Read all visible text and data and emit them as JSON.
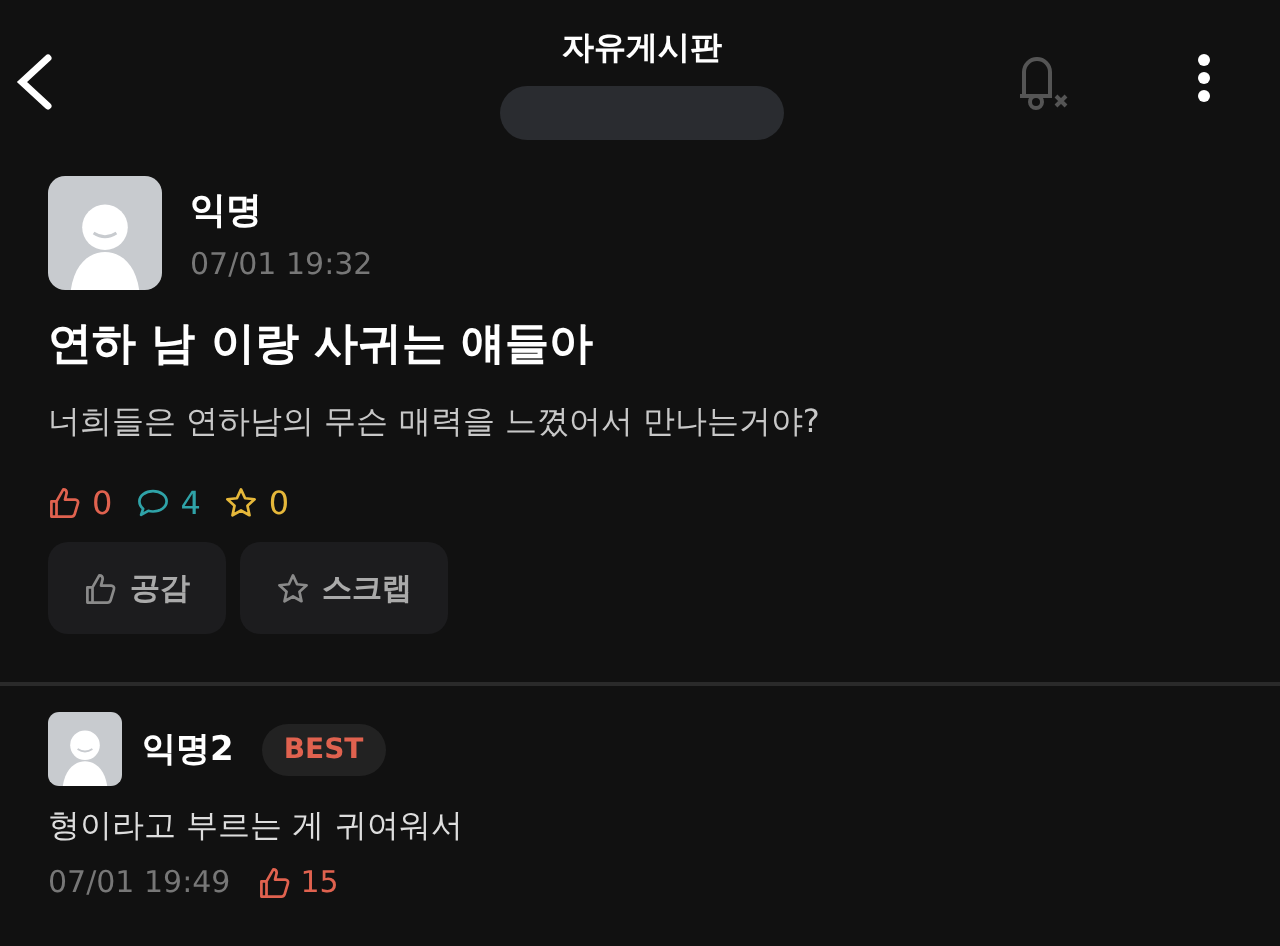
{
  "header": {
    "title": "자유게시판"
  },
  "post": {
    "author": "익명",
    "time": "07/01 19:32",
    "title": "연하 남 이랑 사귀는 얘들아",
    "body": "너희들은 연하남의 무슨 매력을 느꼈어서 만나는거야?",
    "stats": [
      {
        "kind": "like",
        "count": "0",
        "color": "#e0624f"
      },
      {
        "kind": "comment",
        "count": "4",
        "color": "#2fa3a8"
      },
      {
        "kind": "scrap",
        "count": "0",
        "color": "#e6b83a"
      }
    ],
    "actions": [
      {
        "kind": "like",
        "label": "공감"
      },
      {
        "kind": "scrap",
        "label": "스크랩"
      }
    ]
  },
  "comments": [
    {
      "author": "익명2",
      "best": true,
      "badge": "BEST",
      "text": "형이라고 부르는 게 귀여워서",
      "time": "07/01 19:49",
      "likes": "15"
    }
  ]
}
